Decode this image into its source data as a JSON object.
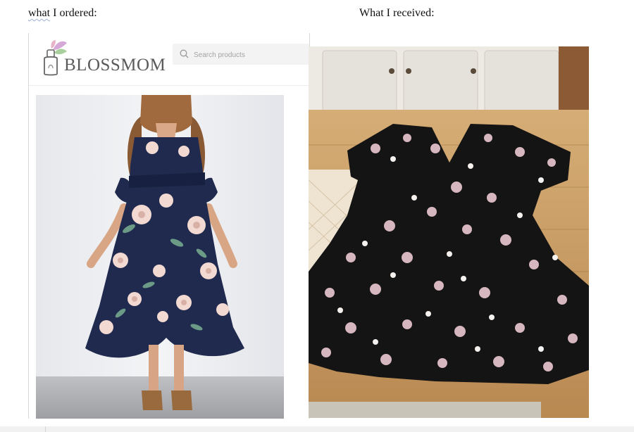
{
  "captions": {
    "ordered_word": "what",
    "ordered_rest": " I ordered:",
    "received": "What I received:"
  },
  "shop": {
    "brand": "BLOSSMOM",
    "search_placeholder": "Search products",
    "logo_icon": "perfume-bottle-flower-icon",
    "search_icon": "search-icon"
  },
  "colors": {
    "navy_dress": "#1f2a4e",
    "black_dress": "#141414",
    "table_wood": "#c69a62",
    "brand_text": "#5b5b5b"
  }
}
